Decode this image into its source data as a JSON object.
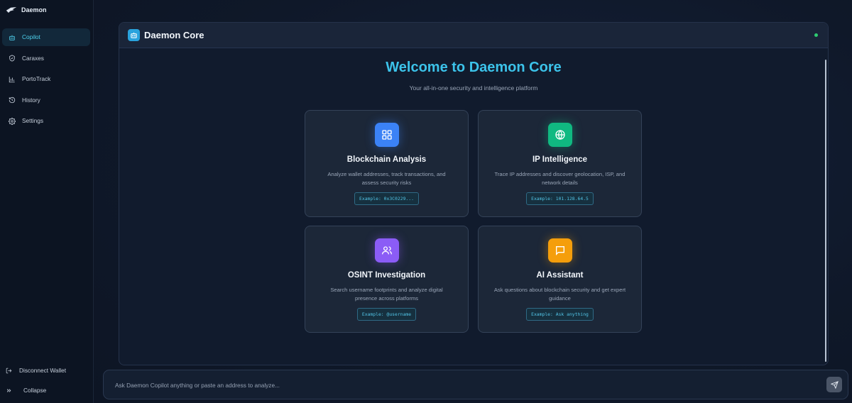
{
  "brand": {
    "name": "Daemon"
  },
  "sidebar": {
    "items": [
      {
        "label": "Copilot",
        "icon": "bot-icon",
        "active": true
      },
      {
        "label": "Caraxes",
        "icon": "shield-icon",
        "active": false
      },
      {
        "label": "PortoTrack",
        "icon": "bar-chart-icon",
        "active": false
      },
      {
        "label": "History",
        "icon": "history-icon",
        "active": false
      },
      {
        "label": "Settings",
        "icon": "gear-icon",
        "active": false
      }
    ],
    "disconnect_label": "Disconnect Wallet",
    "collapse_label": "Collapse"
  },
  "panel": {
    "title": "Daemon Core",
    "status_color": "#2ecc71"
  },
  "welcome": {
    "heading": "Welcome to Daemon Core",
    "tagline": "Your all-in-one security and intelligence platform"
  },
  "cards": [
    {
      "title": "Blockchain Analysis",
      "desc": "Analyze wallet addresses, track transactions, and assess security risks",
      "example": "Example: 0x3C0229...",
      "icon": "grid-icon",
      "color": "#3b82f6"
    },
    {
      "title": "IP Intelligence",
      "desc": "Trace IP addresses and discover geolocation, ISP, and network details",
      "example": "Example: 101.128.64.5",
      "icon": "globe-icon",
      "color": "#10b981"
    },
    {
      "title": "OSINT Investigation",
      "desc": "Search username footprints and analyze digital presence across platforms",
      "example": "Example: @username",
      "icon": "users-icon",
      "color": "#8b5cf6"
    },
    {
      "title": "AI Assistant",
      "desc": "Ask questions about blockchain security and get expert guidance",
      "example": "Example: Ask anything",
      "icon": "message-icon",
      "color": "#f59e0b"
    }
  ],
  "chat": {
    "placeholder": "Ask Daemon Copilot anything or paste an address to analyze...",
    "value": ""
  }
}
